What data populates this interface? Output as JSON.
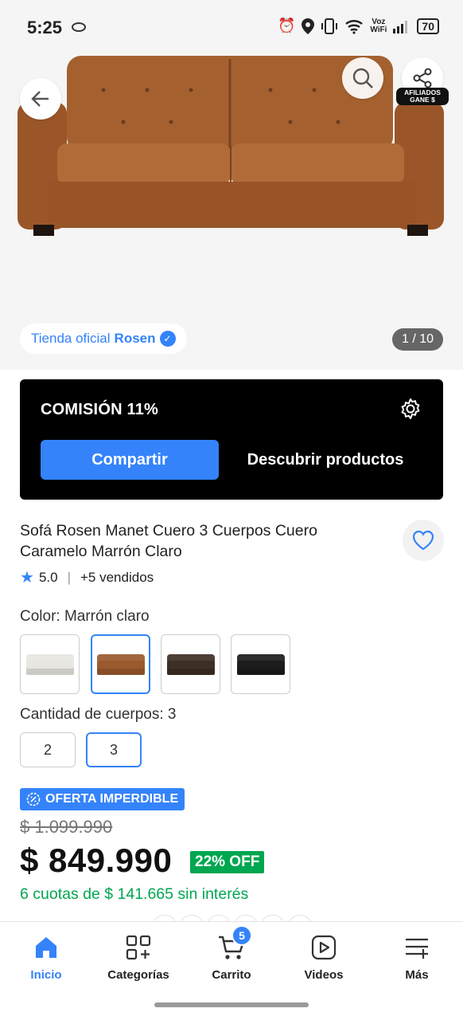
{
  "status_bar": {
    "time": "5:25",
    "voz_line1": "Voz",
    "voz_line2": "WiFi",
    "battery": "70"
  },
  "hero": {
    "store_prefix": "Tienda oficial",
    "store_name": "Rosen",
    "image_counter": "1 / 10",
    "afiliados_line1": "AFILIADOS",
    "afiliados_line2": "GANE $",
    "icons": [
      "arrow-left-icon",
      "search-icon",
      "share-icon",
      "verified-icon"
    ]
  },
  "commission": {
    "title": "COMISIÓN 11%",
    "share_label": "Compartir",
    "discover_label": "Descubrir productos"
  },
  "product": {
    "title": "Sofá Rosen Manet Cuero 3 Cuerpos Cuero Caramelo Marrón Claro",
    "rating": "5.0",
    "sold": "+5 vendidos",
    "color_label": "Color: Marrón claro",
    "swatch_colors": [
      "#e8e6e1",
      "#9a5a2e",
      "#3e2e26",
      "#1c1c1c"
    ],
    "selected_swatch": 1,
    "cuerpos_label": "Cantidad de cuerpos: 3",
    "cuerpos_options": [
      "2",
      "3"
    ],
    "selected_cuerpos": "3"
  },
  "pricing": {
    "badge": "OFERTA IMPERDIBLE",
    "old_price": "$ 1.099.990",
    "price": "$ 849.990",
    "discount": "22% OFF",
    "installments": "6 cuotas de $ 141.665 sin interés"
  },
  "bottom_nav": {
    "items": [
      {
        "label": "Inicio",
        "icon": "home-icon"
      },
      {
        "label": "Categorías",
        "icon": "categories-icon"
      },
      {
        "label": "Carrito",
        "icon": "cart-icon"
      },
      {
        "label": "Videos",
        "icon": "video-icon"
      },
      {
        "label": "Más",
        "icon": "menu-plus-icon"
      }
    ],
    "cart_count": "5",
    "active_index": 0
  },
  "colors": {
    "accent": "#3483fa",
    "green": "#00a650",
    "dark": "#000000"
  }
}
